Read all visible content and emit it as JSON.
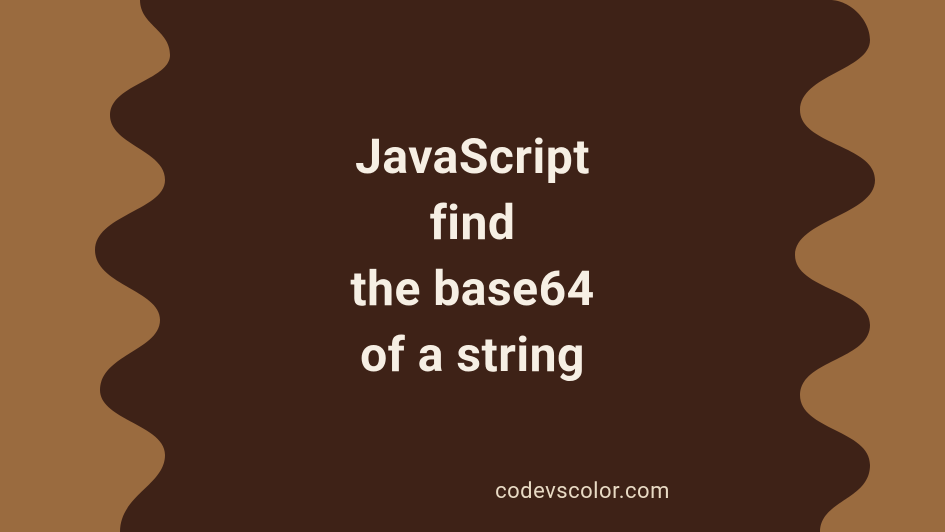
{
  "title": {
    "line1": "JavaScript",
    "line2": "find",
    "line3": "the base64",
    "line4": "of a string"
  },
  "site": "codevscolor.com",
  "colors": {
    "background": "#9A6B3F",
    "blob": "#3E2217",
    "text": "#F6EFE4",
    "subtext": "#E8DAC4"
  }
}
